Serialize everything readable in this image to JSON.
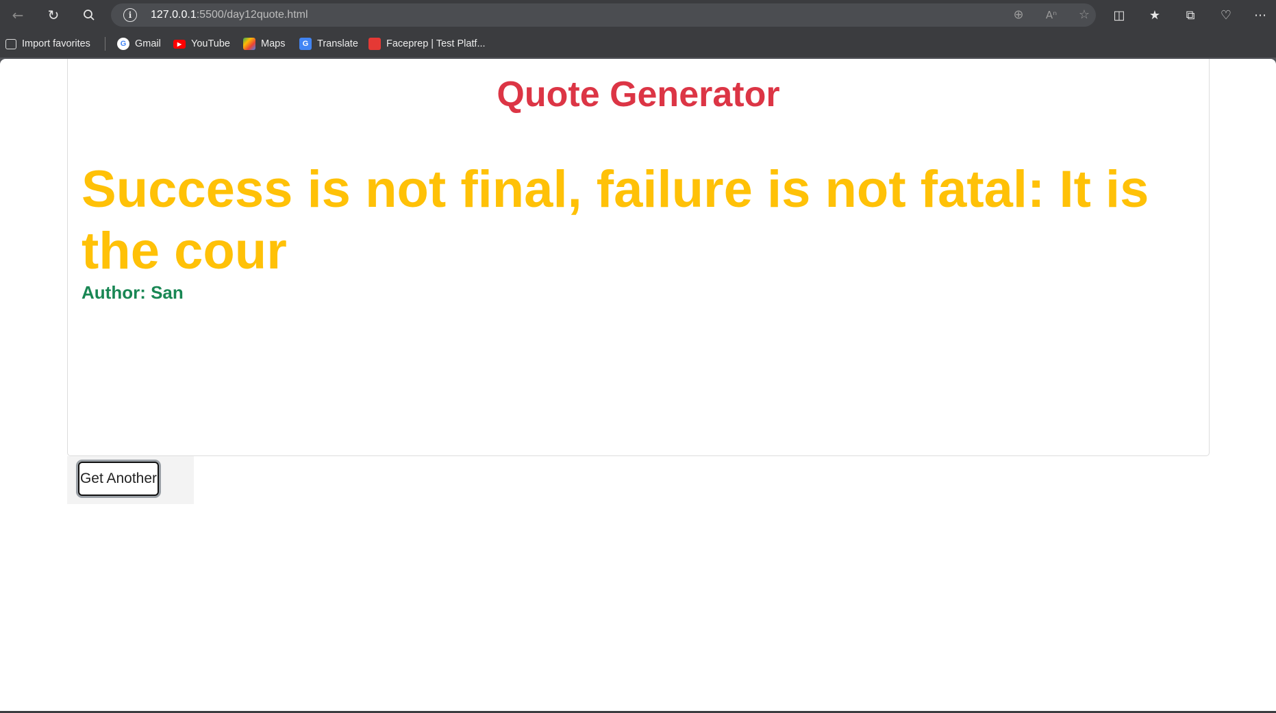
{
  "browser": {
    "url_host": "127.0.0.1",
    "url_path": ":5500/day12quote.html",
    "favorites": [
      {
        "label": "Import favorites",
        "icon": "import-icon"
      },
      {
        "label": "Gmail",
        "icon": "google-icon"
      },
      {
        "label": "YouTube",
        "icon": "youtube-icon"
      },
      {
        "label": "Maps",
        "icon": "maps-icon"
      },
      {
        "label": "Translate",
        "icon": "translate-icon"
      },
      {
        "label": "Faceprep | Test Platf...",
        "icon": "faceprep-icon"
      }
    ],
    "colors": {
      "chrome": "#3b3c3f",
      "address_bar": "#4b4d51"
    }
  },
  "page": {
    "title": "Quote Generator",
    "quote": "Success is not final, failure is not fatal: It is the cour",
    "author": "Author: San",
    "button_label": "Get Another",
    "colors": {
      "title": "#dc3545",
      "quote": "#ffc107",
      "author": "#198754"
    }
  }
}
